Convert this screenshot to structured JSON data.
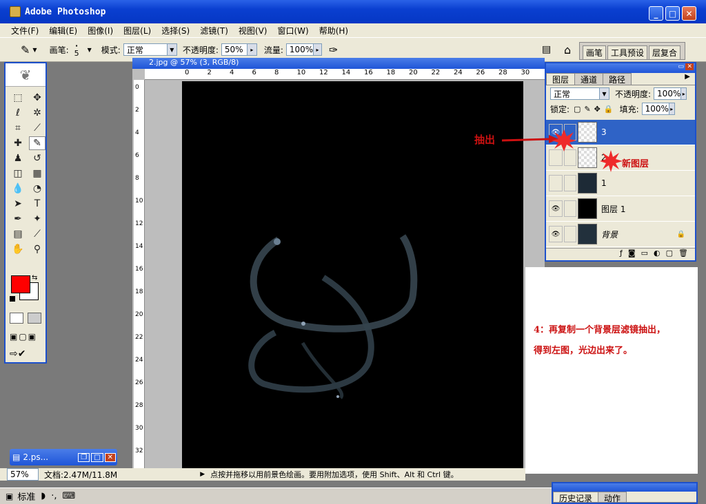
{
  "window": {
    "title": "Adobe Photoshop",
    "min": "_",
    "max": "□",
    "close": "✕"
  },
  "menu": [
    "文件(F)",
    "编辑(E)",
    "图像(I)",
    "图层(L)",
    "选择(S)",
    "滤镜(T)",
    "视图(V)",
    "窗口(W)",
    "帮助(H)"
  ],
  "options": {
    "brush_label": "画笔:",
    "brush_size": "5",
    "mode_label": "模式:",
    "mode_value": "正常",
    "opacity_label": "不透明度:",
    "opacity_value": "50%",
    "flow_label": "流量:",
    "flow_value": "100%",
    "well_tabs": [
      "画笔",
      "工具预设",
      "层复合"
    ]
  },
  "document": {
    "title": "2.jpg @ 57% (3, RGB/8)",
    "ruler_h": [
      "0",
      "2",
      "4",
      "6",
      "8",
      "10",
      "12",
      "14",
      "16",
      "18",
      "20",
      "22",
      "24",
      "26",
      "28",
      "30"
    ],
    "ruler_v": [
      "0",
      "2",
      "4",
      "6",
      "8",
      "10",
      "12",
      "14",
      "16",
      "18",
      "20",
      "22",
      "24",
      "26",
      "28",
      "30",
      "32"
    ]
  },
  "layers_panel": {
    "tabs": [
      "图层",
      "通道",
      "路径"
    ],
    "blend_mode": "正常",
    "opacity_label": "不透明度:",
    "opacity_value": "100%",
    "lock_label": "锁定:",
    "fill_label": "填充:",
    "fill_value": "100%",
    "layers": [
      {
        "name": "3",
        "visible": true,
        "selected": true
      },
      {
        "name": "2",
        "visible": false,
        "selected": false
      },
      {
        "name": "1",
        "visible": false,
        "selected": false
      },
      {
        "name": "图层 1",
        "visible": true,
        "selected": false
      },
      {
        "name": "背景",
        "visible": true,
        "selected": false
      }
    ]
  },
  "annotations": {
    "extract": "抽出",
    "new_layer": "新图层",
    "note_line1": "4：再复制一个背景层滤镜抽出，",
    "note_line2": "得到左图，光边出来了。"
  },
  "status": {
    "zoom": "57%",
    "doc_info": "文档:2.47M/11.8M",
    "hint": "点按并拖移以用前景色绘画。要用附加选项，使用 Shift、Alt 和 Ctrl 键。"
  },
  "minimized_doc": "2.ps...",
  "taskbar": {
    "ime": "标准"
  },
  "history_panel": {
    "tabs": [
      "历史记录",
      "动作"
    ]
  },
  "colors": {
    "foreground": "#ff0000",
    "background": "#ffffff",
    "accent": "#1c50cc",
    "annotation": "#cc1111"
  }
}
